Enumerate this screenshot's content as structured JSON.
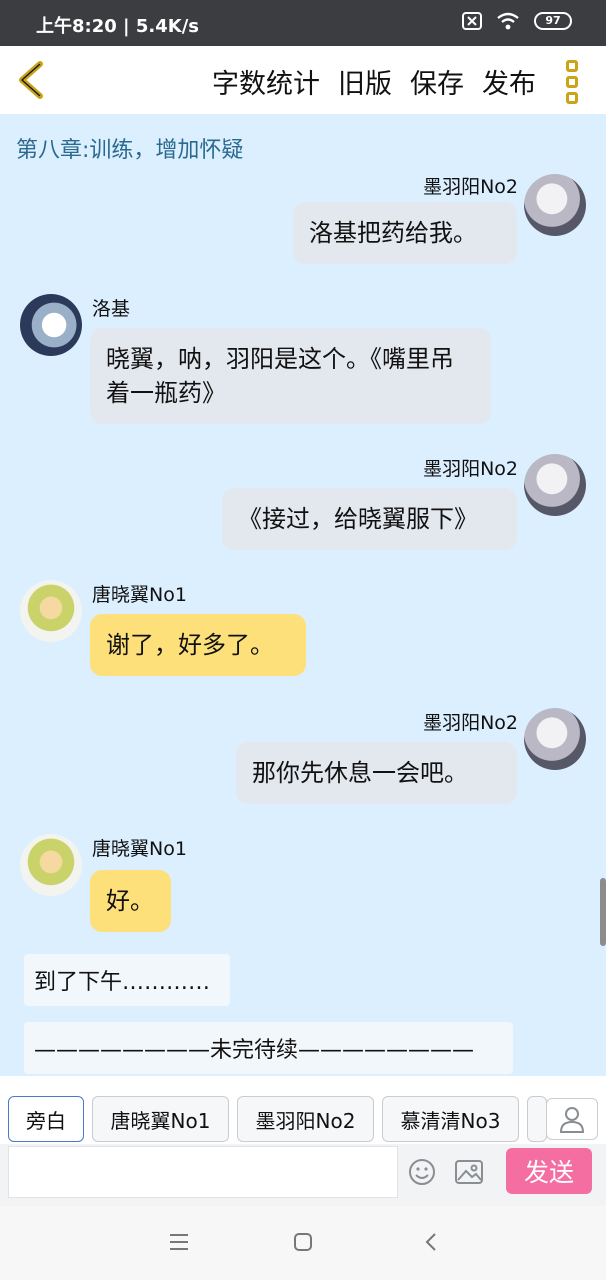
{
  "status_bar": {
    "time": "上午8:20 | 5.4K/s",
    "battery": "97"
  },
  "toolbar": {
    "word_count": "字数统计",
    "old_version": "旧版",
    "save": "保存",
    "publish": "发布"
  },
  "chapter_title": "第八章:训练，增加怀疑",
  "messages": [
    {
      "sender": "墨羽阳No2",
      "text": "洛基把药给我。"
    },
    {
      "sender": "洛基",
      "text": "晓翼，呐，羽阳是这个。《嘴里吊着一瓶药》"
    },
    {
      "sender": "墨羽阳No2",
      "text": "《接过，给晓翼服下》"
    },
    {
      "sender": "唐晓翼No1",
      "text": "谢了，好多了。"
    },
    {
      "sender": "墨羽阳No2",
      "text": "那你先休息一会吧。"
    },
    {
      "sender": "唐晓翼No1",
      "text": "好。"
    }
  ],
  "narration": [
    "到了下午…………",
    "————————未完待续————————"
  ],
  "roles": [
    "旁白",
    "唐晓翼No1",
    "墨羽阳No2",
    "慕清清No3"
  ],
  "input": {
    "placeholder": "",
    "send_label": "发送"
  },
  "colors": {
    "chat_bg": "#dcefff",
    "bubble_gray": "#e3e7ee",
    "bubble_yellow": "#fde07a",
    "send": "#f46ea2",
    "accent": "#c9a41b"
  }
}
